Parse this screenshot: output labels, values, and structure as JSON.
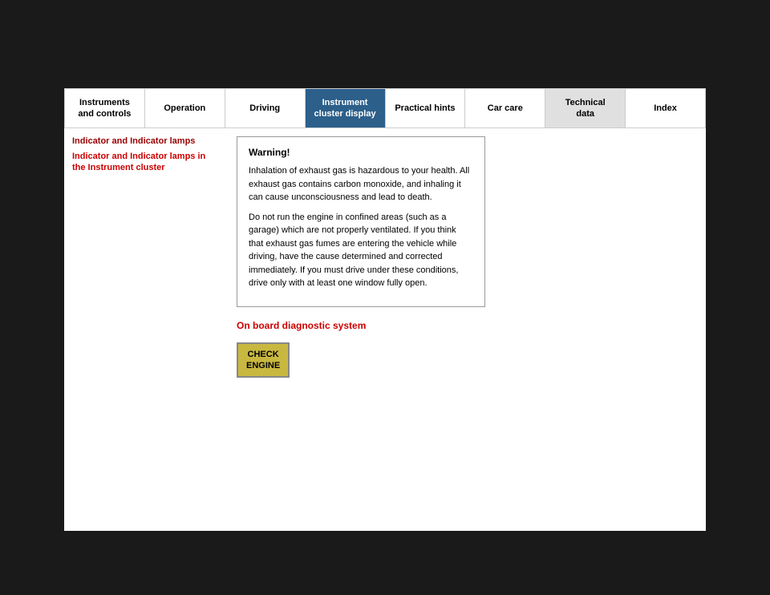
{
  "nav": {
    "items": [
      {
        "id": "instruments-and-controls",
        "label": "Instruments\nand controls",
        "active": false
      },
      {
        "id": "operation",
        "label": "Operation",
        "active": false
      },
      {
        "id": "driving",
        "label": "Driving",
        "active": false
      },
      {
        "id": "instrument-cluster-display",
        "label": "Instrument\ncluster display",
        "active": true
      },
      {
        "id": "practical-hints",
        "label": "Practical hints",
        "active": false
      },
      {
        "id": "car-care",
        "label": "Car care",
        "active": false
      },
      {
        "id": "technical-data",
        "label": "Technical\ndata",
        "active": false
      },
      {
        "id": "index",
        "label": "Index",
        "active": false
      }
    ]
  },
  "sidebar": {
    "section_title": "Indicator and Indicator lamps",
    "sub_title": "Indicator and Indicator lamps\nin the Instrument cluster"
  },
  "warning": {
    "title": "Warning!",
    "paragraph1": "Inhalation of exhaust gas is hazardous to your health. All exhaust gas contains carbon monoxide, and inhaling it can cause unconsciousness and lead to death.",
    "paragraph2": "Do not run the engine in confined areas (such as a garage) which are not properly ventilated. If you think that exhaust gas fumes are entering the vehicle while driving, have the cause determined and corrected immediately. If you must drive under these conditions, drive only with at least one window fully open."
  },
  "diagnostic": {
    "link_text": "On board diagnostic system"
  },
  "check_engine": {
    "label": "CHECK\nENGINE"
  }
}
